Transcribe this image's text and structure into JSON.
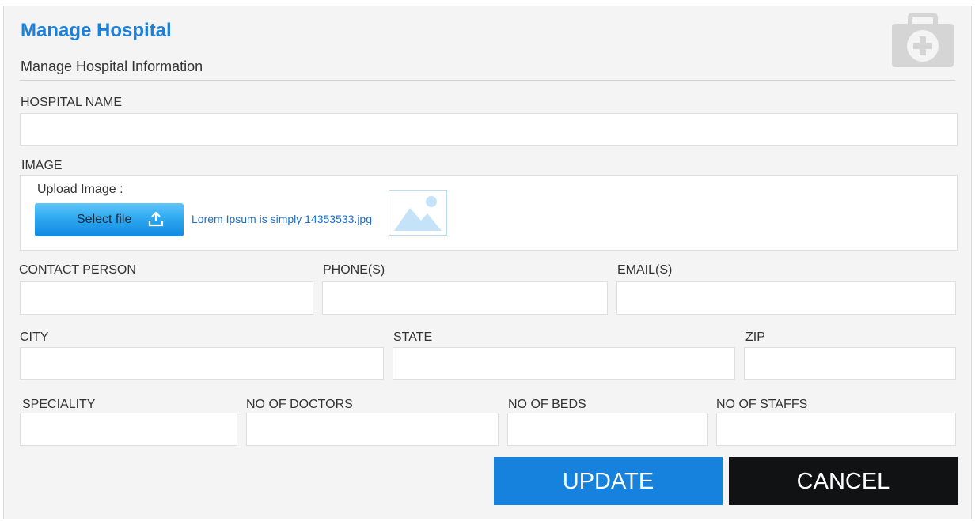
{
  "header": {
    "title": "Manage Hospital",
    "subtitle": "Manage Hospital Information",
    "icon": "medical-kit-icon"
  },
  "form": {
    "hospital_name": {
      "label": "HOSPITAL NAME",
      "value": "",
      "placeholder": ""
    },
    "image": {
      "label": "IMAGE",
      "upload_label": "Upload Image :",
      "select_button": "Select file",
      "select_icon": "upload-icon",
      "filename": "Lorem Ipsum is simply 14353533.jpg",
      "thumbnail_icon": "image-placeholder-icon"
    },
    "contact_person": {
      "label": "CONTACT PERSON",
      "value": "",
      "placeholder": ""
    },
    "phones": {
      "label": "PHONE(S)",
      "value": "",
      "placeholder": ""
    },
    "emails": {
      "label": "EMAIL(S)",
      "value": "",
      "placeholder": ""
    },
    "city": {
      "label": "CITY",
      "value": "",
      "placeholder": ""
    },
    "state": {
      "label": "STATE",
      "value": "",
      "placeholder": ""
    },
    "zip": {
      "label": "ZIP",
      "value": "",
      "placeholder": ""
    },
    "speciality": {
      "label": "SPECIALITY",
      "value": "",
      "placeholder": ""
    },
    "no_of_doctors": {
      "label": "NO OF DOCTORS",
      "value": "",
      "placeholder": ""
    },
    "no_of_beds": {
      "label": "NO OF BEDS",
      "value": "",
      "placeholder": ""
    },
    "no_of_staffs": {
      "label": "NO OF STAFFS",
      "value": "",
      "placeholder": ""
    }
  },
  "actions": {
    "update_label": "UPDATE",
    "cancel_label": "CANCEL"
  },
  "colors": {
    "accent": "#1b80dd",
    "update_bg": "#1782dd",
    "cancel_bg": "#111213",
    "panel_bg": "#f4f4f4"
  }
}
